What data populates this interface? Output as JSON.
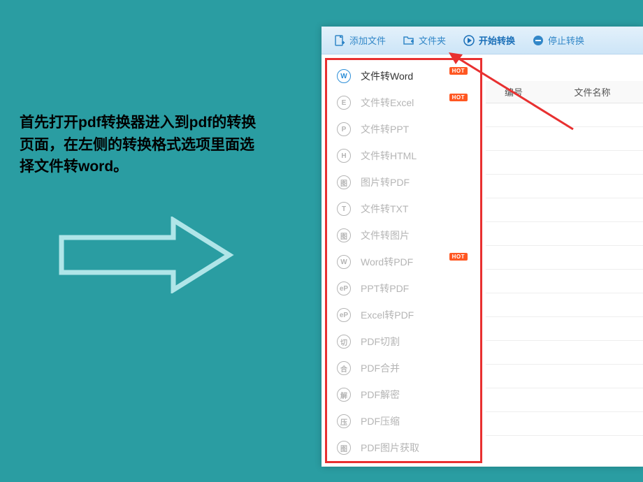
{
  "instruction": "首先打开pdf转换器进入到pdf的转换页面，在左侧的转换格式选项里面选择文件转word。",
  "toolbar": {
    "addFile": "添加文件",
    "folder": "文件夹",
    "start": "开始转换",
    "stop": "停止转换"
  },
  "sidebar": {
    "items": [
      {
        "icon": "W",
        "label": "文件转Word",
        "active": true,
        "hot": true
      },
      {
        "icon": "E",
        "label": "文件转Excel",
        "active": false,
        "hot": true
      },
      {
        "icon": "P",
        "label": "文件转PPT",
        "active": false,
        "hot": false
      },
      {
        "icon": "H",
        "label": "文件转HTML",
        "active": false,
        "hot": false
      },
      {
        "icon": "图",
        "label": "图片转PDF",
        "active": false,
        "hot": false
      },
      {
        "icon": "T",
        "label": "文件转TXT",
        "active": false,
        "hot": false
      },
      {
        "icon": "图",
        "label": "文件转图片",
        "active": false,
        "hot": false
      },
      {
        "icon": "W",
        "label": "Word转PDF",
        "active": false,
        "hot": true
      },
      {
        "icon": "eP",
        "label": "PPT转PDF",
        "active": false,
        "hot": false
      },
      {
        "icon": "eP",
        "label": "Excel转PDF",
        "active": false,
        "hot": false
      },
      {
        "icon": "切",
        "label": "PDF切割",
        "active": false,
        "hot": false
      },
      {
        "icon": "合",
        "label": "PDF合并",
        "active": false,
        "hot": false
      },
      {
        "icon": "解",
        "label": "PDF解密",
        "active": false,
        "hot": false
      },
      {
        "icon": "压",
        "label": "PDF压缩",
        "active": false,
        "hot": false
      },
      {
        "icon": "图",
        "label": "PDF图片获取",
        "active": false,
        "hot": false
      }
    ]
  },
  "table": {
    "headerNumber": "编号",
    "headerFilename": "文件名称"
  },
  "hotLabel": "HOT"
}
